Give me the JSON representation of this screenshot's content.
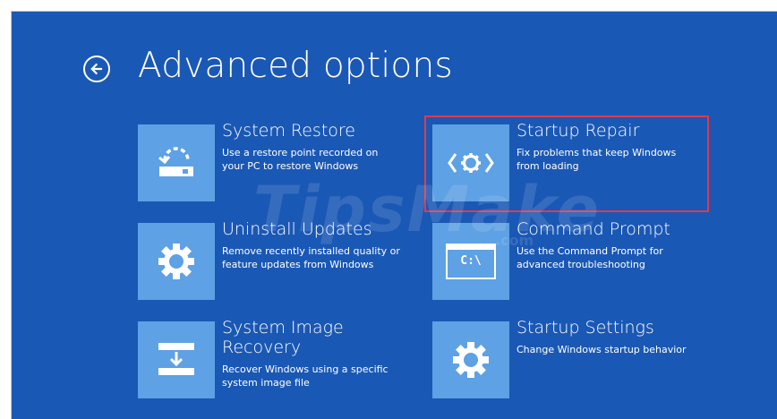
{
  "screen": {
    "title": "Advanced options",
    "background_color": "#1a58b5",
    "tile_color": "#5ea1e4",
    "highlight_color": "#e2394a"
  },
  "watermark": {
    "brand": "TipsMake",
    "domain": ".com"
  },
  "options": [
    {
      "title": "System Restore",
      "description": "Use a restore point recorded on your PC to restore Windows",
      "icon": "system-restore-icon"
    },
    {
      "title": "Startup Repair",
      "description": "Fix problems that keep Windows from loading",
      "icon": "startup-repair-icon",
      "highlighted": true
    },
    {
      "title": "Uninstall Updates",
      "description": "Remove recently installed quality or feature updates from Windows",
      "icon": "gear-icon"
    },
    {
      "title": "Command Prompt",
      "description": "Use the Command Prompt for advanced troubleshooting",
      "icon": "command-prompt-icon",
      "prompt_text": "C:\\"
    },
    {
      "title": "System Image Recovery",
      "description": "Recover Windows using a specific system image file",
      "icon": "system-image-recovery-icon"
    },
    {
      "title": "Startup Settings",
      "description": "Change Windows startup behavior",
      "icon": "gear-icon"
    }
  ]
}
